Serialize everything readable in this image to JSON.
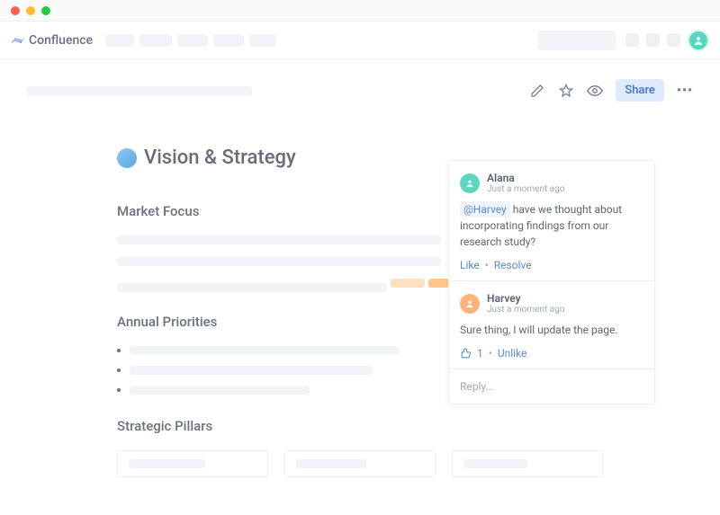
{
  "brand": {
    "name": "Confluence"
  },
  "actions": {
    "share_label": "Share"
  },
  "page": {
    "title": "Vision & Strategy",
    "sections": {
      "market_focus": "Market Focus",
      "annual_priorities": "Annual Priorities",
      "strategic_pillars": "Strategic Pillars"
    }
  },
  "comments": [
    {
      "author": "Alana",
      "time": "Just a moment ago",
      "mention": "@Harvey",
      "body_rest": " have we thought about incorporating findings from our research study?",
      "actions": {
        "like": "Like",
        "resolve": "Resolve"
      }
    },
    {
      "author": "Harvey",
      "time": "Just a moment ago",
      "body": "Sure thing, I will update the page.",
      "like_count": "1",
      "actions": {
        "unlike": "Unlike"
      }
    }
  ],
  "reply_placeholder": "Reply..."
}
